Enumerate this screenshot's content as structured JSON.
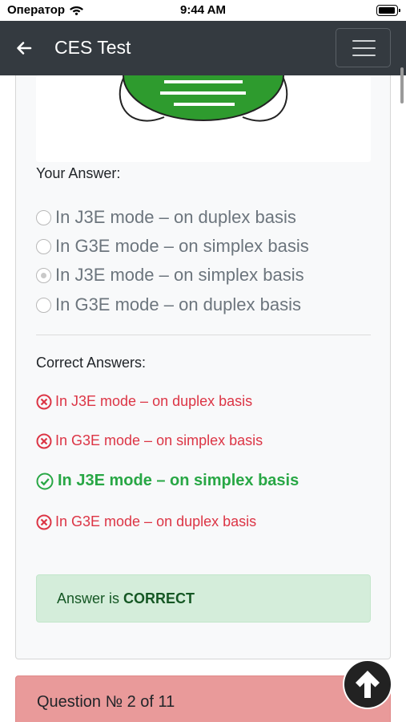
{
  "status_bar": {
    "carrier": "Оператор",
    "time": "9:44 AM"
  },
  "navbar": {
    "title": "CES Test"
  },
  "question": {
    "your_answer_label": "Your Answer:",
    "options": [
      {
        "label": "In J3E mode – on duplex basis",
        "selected": false
      },
      {
        "label": "In G3E mode – on simplex basis",
        "selected": false
      },
      {
        "label": "In J3E mode – on simplex basis",
        "selected": true
      },
      {
        "label": "In G3E mode – on duplex basis",
        "selected": false
      }
    ],
    "correct_answers_label": "Correct Answers:",
    "answers": [
      {
        "label": "In J3E mode – on duplex basis",
        "correct": false
      },
      {
        "label": "In G3E mode – on simplex basis",
        "correct": false
      },
      {
        "label": "In J3E mode – on simplex basis",
        "correct": true
      },
      {
        "label": "In G3E mode – on duplex basis",
        "correct": false
      }
    ],
    "result_prefix": "Answer is",
    "result_value": "CORRECT"
  },
  "next_question": {
    "label": "Question № 2 of 11"
  },
  "colors": {
    "navbar": "#343a40",
    "wrong": "#dc3545",
    "correct": "#28a745",
    "success_bg": "#d4edda",
    "question_bg": "#e99a9a"
  }
}
